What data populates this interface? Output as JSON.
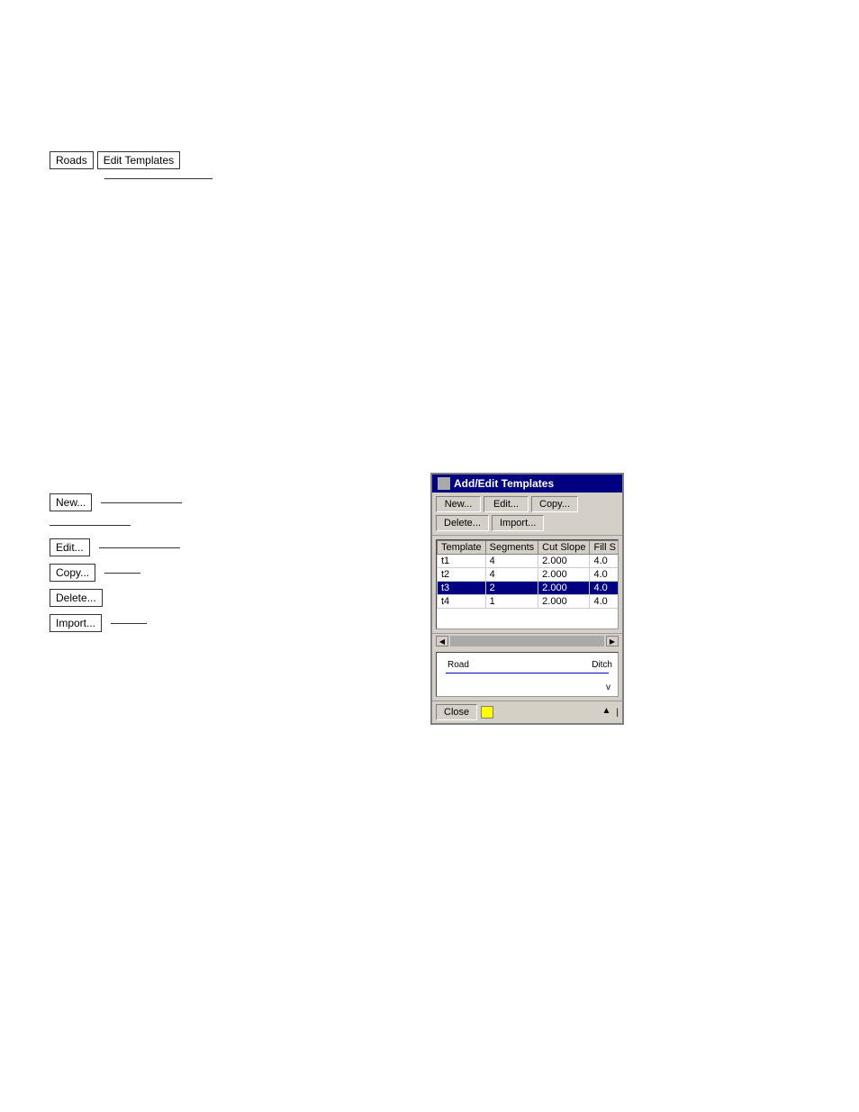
{
  "breadcrumb": {
    "roads_label": "Roads",
    "edit_templates_label": "Edit Templates"
  },
  "left_panel": {
    "new_label": "New...",
    "edit_label": "Edit...",
    "copy_label": "Copy...",
    "delete_label": "Delete...",
    "import_label": "Import..."
  },
  "dialog": {
    "title": "Add/Edit Templates",
    "buttons": {
      "new": "New...",
      "edit": "Edit...",
      "copy": "Copy...",
      "delete": "Delete...",
      "import": "Import..."
    },
    "table": {
      "columns": [
        "Template",
        "Segments",
        "Cut Slope",
        "Fill S"
      ],
      "rows": [
        {
          "template": "t1",
          "segments": "4",
          "cut_slope": "2.000",
          "fill_s": "4.0",
          "selected": false
        },
        {
          "template": "t2",
          "segments": "4",
          "cut_slope": "2.000",
          "fill_s": "4.0",
          "selected": false
        },
        {
          "template": "t3",
          "segments": "2",
          "cut_slope": "2.000",
          "fill_s": "4.0",
          "selected": true
        },
        {
          "template": "t4",
          "segments": "1",
          "cut_slope": "2.000",
          "fill_s": "4.0",
          "selected": false
        }
      ]
    },
    "preview": {
      "road_label": "Road",
      "ditch_label": "Ditch",
      "v_label": "v"
    },
    "close_label": "Close"
  }
}
